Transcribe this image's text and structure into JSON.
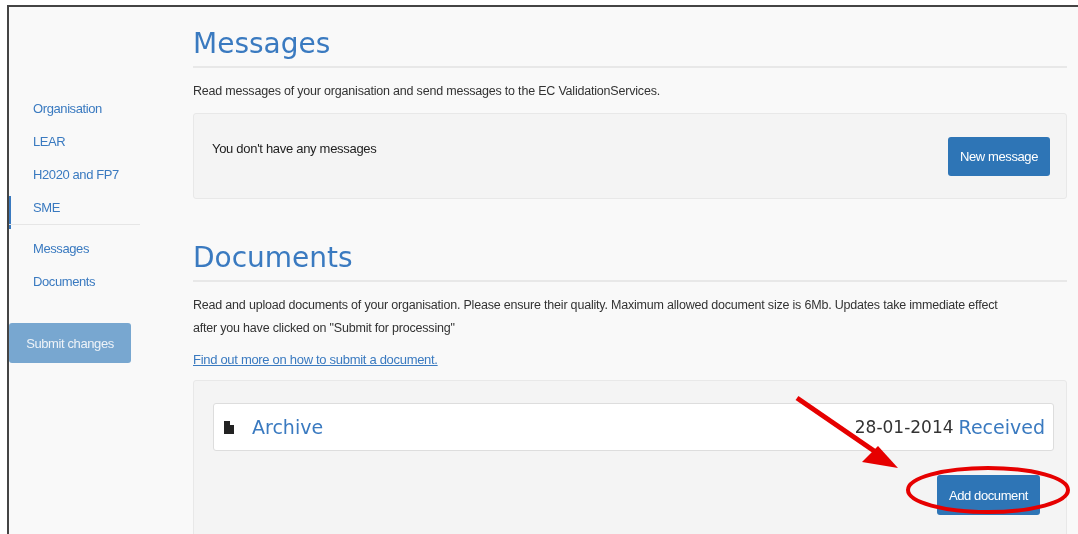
{
  "sidebar": {
    "groups": [
      [
        {
          "label": "Organisation",
          "selected": false
        },
        {
          "label": "LEAR",
          "selected": false
        },
        {
          "label": "H2020 and FP7",
          "selected": false
        },
        {
          "label": "SME",
          "selected": true
        }
      ],
      [
        {
          "label": "Messages",
          "selected": false
        },
        {
          "label": "Documents",
          "selected": false
        }
      ]
    ],
    "submit_button": {
      "label": "Submit changes",
      "disabled": true
    }
  },
  "messages": {
    "title": "Messages",
    "description": "Read messages of your organisation and send messages to the EC ValidationServices.",
    "empty_text": "You don't have any messages",
    "button": "New message"
  },
  "documents": {
    "title": "Documents",
    "description": "Read and upload documents of your organisation. Please ensure their quality. Maximum allowed document size is 6Mb. Updates take immediate effect after you have clicked on \"Submit for processing\"",
    "link": "Find out more on how to submit a document.",
    "items": [
      {
        "name": "Archive",
        "date": "28-01-2014",
        "status": "Received"
      }
    ],
    "button": "Add document"
  }
}
